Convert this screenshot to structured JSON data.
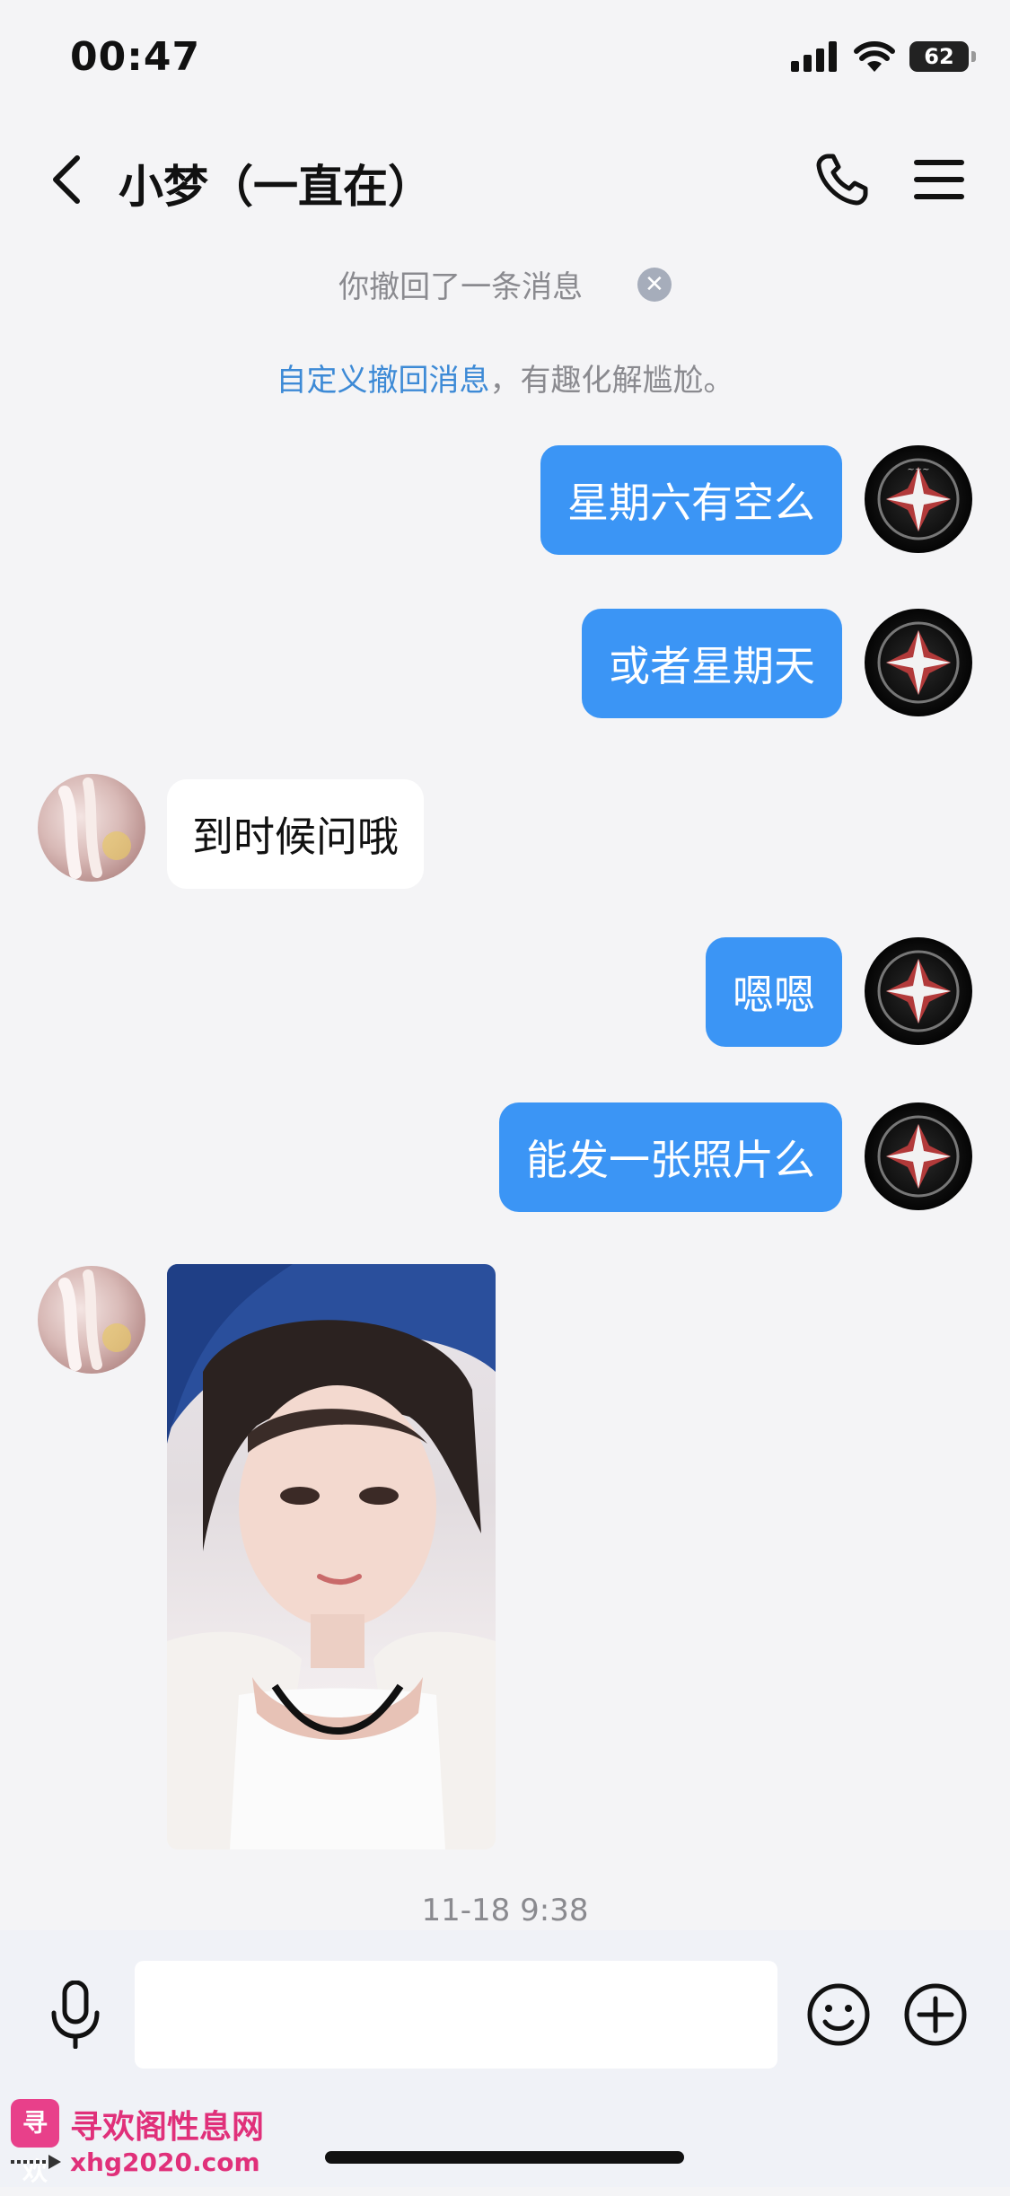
{
  "status_bar": {
    "time": "00:47",
    "battery": "62",
    "icons": [
      "signal-icon",
      "wifi-icon",
      "battery-icon"
    ]
  },
  "nav": {
    "title": "小梦（一直在）",
    "icons": [
      "back-icon",
      "phone-icon",
      "menu-icon"
    ]
  },
  "system": {
    "recall_text": "你撤回了一条消息",
    "tip_link": "自定义撤回消息",
    "tip_rest": "，有趣化解尴尬。"
  },
  "messages": [
    {
      "from": "me",
      "text": "星期六有空么"
    },
    {
      "from": "me",
      "text": "或者星期天"
    },
    {
      "from": "her",
      "text": "到时候问哦"
    },
    {
      "from": "me",
      "text": "嗯嗯"
    },
    {
      "from": "me",
      "text": "能发一张照片么"
    },
    {
      "from": "her",
      "type": "image"
    }
  ],
  "timestamp": "11-18 9:38",
  "input": {
    "value": "",
    "placeholder": "",
    "icons": [
      "mic-icon",
      "emoji-icon",
      "plus-icon"
    ]
  },
  "watermark": {
    "logo": "寻欢",
    "name": "寻欢阁性息网",
    "url": "xhg2020.com"
  },
  "colors": {
    "bubble_out": "#3b95f5",
    "bubble_in": "#ffffff",
    "background": "#f4f4f6",
    "link": "#3d8ad6"
  }
}
